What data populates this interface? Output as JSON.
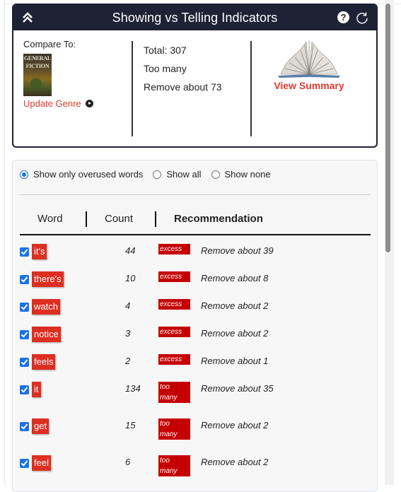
{
  "header": {
    "title": "Showing vs Telling Indicators",
    "collapse_icon": "double-chevron-up-icon",
    "help_icon": "question-circle-icon",
    "help_glyph": "?",
    "refresh_icon": "refresh-icon"
  },
  "compare": {
    "label": "Compare To:",
    "genre_cover_text_1": "GENERAL",
    "genre_cover_text_2": "FICTION",
    "update_genre": "Update Genre"
  },
  "stats": {
    "total": "Total: 307",
    "status": "Too many",
    "recommendation": "Remove about 73"
  },
  "summary": {
    "view_summary": "View Summary"
  },
  "filters": {
    "options": [
      {
        "label": "Show only overused words",
        "checked": true
      },
      {
        "label": "Show all",
        "checked": false
      },
      {
        "label": "Show none",
        "checked": false
      }
    ]
  },
  "table": {
    "headers": {
      "word": "Word",
      "count": "Count",
      "recommendation": "Recommendation"
    },
    "rows": [
      {
        "checked": true,
        "word": "it's",
        "count": "44",
        "badge": "excess",
        "recommendation": "Remove about 39"
      },
      {
        "checked": true,
        "word": "there's",
        "count": "10",
        "badge": "excess",
        "recommendation": "Remove about 8"
      },
      {
        "checked": true,
        "word": "watch",
        "count": "4",
        "badge": "excess",
        "recommendation": "Remove about 2"
      },
      {
        "checked": true,
        "word": "notice",
        "count": "3",
        "badge": "excess",
        "recommendation": "Remove about 2"
      },
      {
        "checked": true,
        "word": "feels",
        "count": "2",
        "badge": "excess",
        "recommendation": "Remove about 1"
      },
      {
        "checked": true,
        "word": "it",
        "count": "134",
        "badge": "too many",
        "recommendation": "Remove about 35"
      },
      {
        "checked": true,
        "word": "get",
        "count": "15",
        "badge": "too many",
        "recommendation": "Remove about 2"
      },
      {
        "checked": true,
        "word": "feel",
        "count": "6",
        "badge": "too many",
        "recommendation": "Remove about 2"
      }
    ]
  },
  "colors": {
    "header_bg": "#1e2235",
    "accent_red": "#e03a2f",
    "chip_red": "#dc2f22",
    "badge_red": "#c50000",
    "checkbox_blue": "#1a73e8"
  }
}
